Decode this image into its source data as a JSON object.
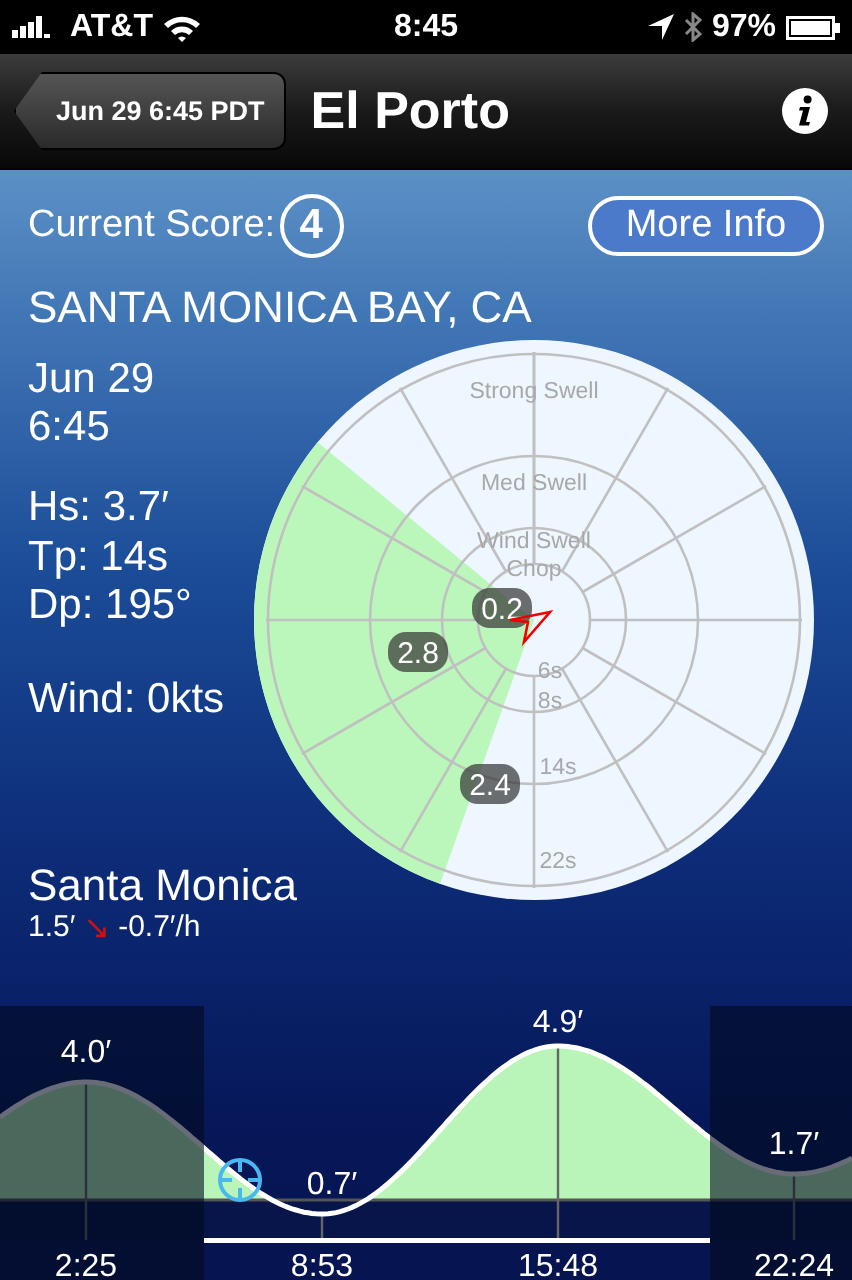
{
  "status_bar": {
    "carrier": "AT&T",
    "time": "8:45",
    "battery": "97%"
  },
  "nav_bar": {
    "back_button": "Jun 29 6:45 PDT",
    "title": "El Porto"
  },
  "score": {
    "label": "Current Score:",
    "value": "4"
  },
  "more_info_button": "More Info",
  "region": "SANTA MONICA BAY, CA",
  "date": "Jun 29",
  "time": "6:45",
  "stats": [
    "Hs: 3.7′",
    "Tp: 14s",
    "Dp: 195°"
  ],
  "wind": "Wind: 0kts",
  "swell_rose": {
    "ring_labels": [
      "Strong Swell",
      "Med Swell",
      "Wind Swell",
      "Chop"
    ],
    "period_labels": [
      "6s",
      "8s",
      "14s",
      "22s"
    ],
    "bubbles": [
      "0.2",
      "2.8",
      "2.4"
    ]
  },
  "tide": {
    "station": "Santa Monica",
    "height": "1.5′",
    "trend_arrow": "↘",
    "rate": "-0.7′/h",
    "extremes": [
      {
        "kind": "high",
        "time": "2:25",
        "height": "4.0′"
      },
      {
        "kind": "low",
        "time": "8:53",
        "height": "0.7′"
      },
      {
        "kind": "high",
        "time": "15:48",
        "height": "4.9′"
      },
      {
        "kind": "low",
        "time": "22:24",
        "height": "1.7′"
      }
    ]
  }
}
